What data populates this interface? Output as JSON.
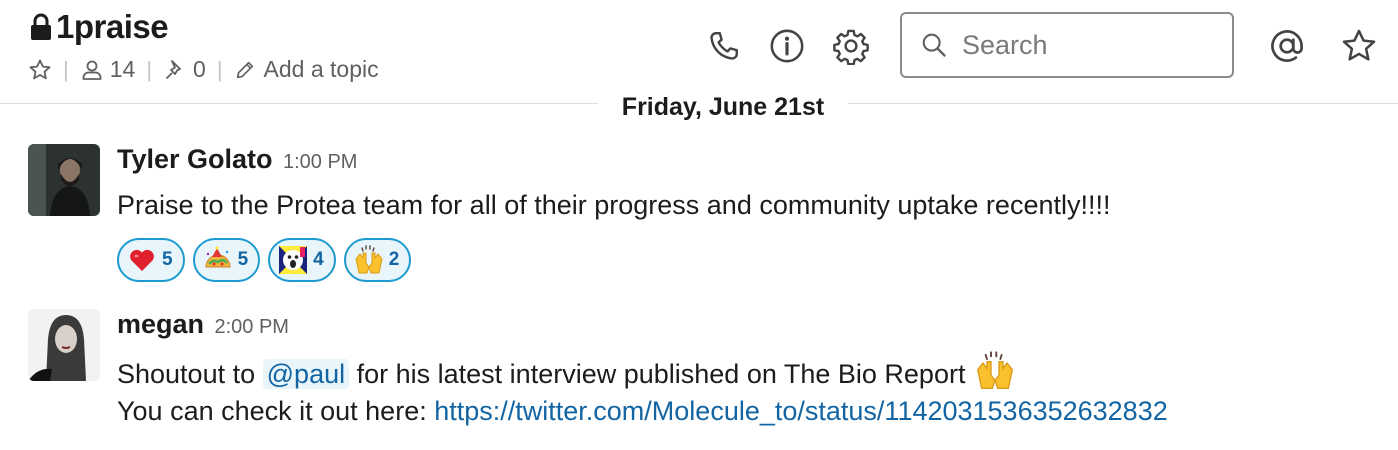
{
  "channel": {
    "name": "1praise",
    "member_count": "14",
    "pinned_count": "0",
    "topic_placeholder": "Add a topic"
  },
  "header": {
    "search_placeholder": "Search",
    "icons": [
      "call-icon",
      "info-icon",
      "settings-icon",
      "mentions-icon",
      "star-icon"
    ]
  },
  "date_divider": "Friday, June 21st",
  "messages": [
    {
      "author": "Tyler Golato",
      "time": "1:00 PM",
      "text": "Praise to the Protea team for all of their progress and community uptake recently!!!!",
      "reactions": [
        {
          "emoji": "heart",
          "count": "5"
        },
        {
          "emoji": "taco-party",
          "count": "5"
        },
        {
          "emoji": "screaming-face",
          "count": "4"
        },
        {
          "emoji": "raised-hands",
          "count": "2"
        }
      ]
    },
    {
      "author": "megan",
      "time": "2:00 PM",
      "line1_before": "Shoutout to",
      "mention": "@paul",
      "line1_after": "for his latest interview published on The Bio Report",
      "line1_emoji": "raised-hands",
      "line2_prefix": "You can check it out here:",
      "link": "https://twitter.com/Molecule_to/status/1142031536352632832"
    }
  ],
  "colors": {
    "link": "#1264a3",
    "reaction_border": "#1d9bd1",
    "reaction_bg": "#e8f5fa",
    "text": "#1d1c1d",
    "muted": "#616061"
  }
}
